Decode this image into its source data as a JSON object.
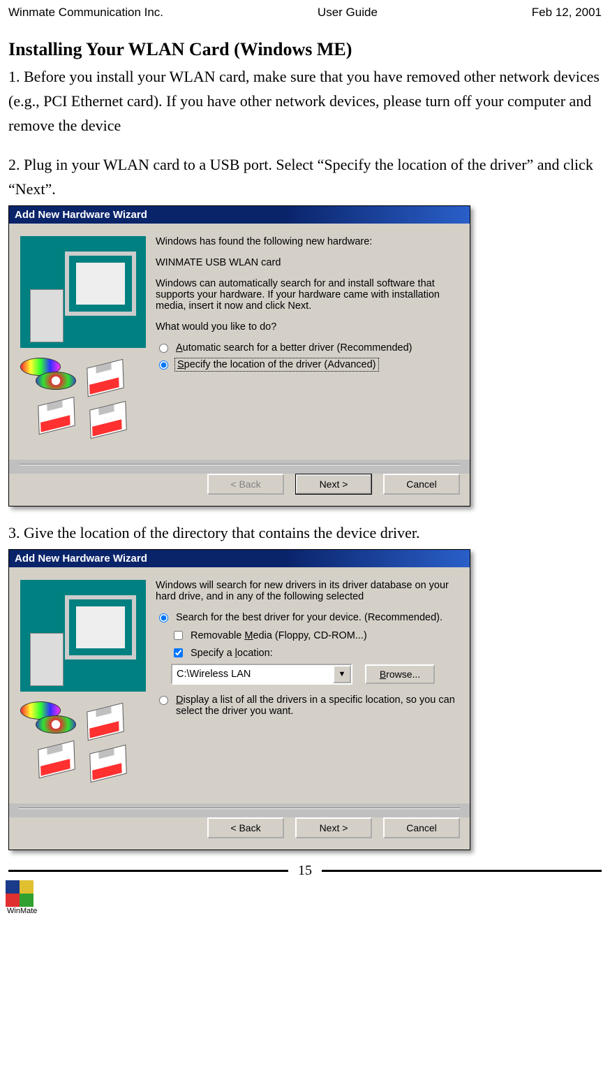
{
  "header": {
    "company": "Winmate Communication Inc.",
    "doc": "User Guide",
    "date": "Feb 12, 2001"
  },
  "sectionTitle": "Installing Your WLAN Card (Windows ME)",
  "para1": "1. Before you install your WLAN card, make sure that you have removed other network devices (e.g., PCI Ethernet card). If you have other network devices, please turn off your computer and remove the device",
  "para2": "2. Plug in your WLAN card to a USB port. Select “Specify the location of the driver” and click “Next”.",
  "para3": "3. Give the location of the directory that contains the device driver.",
  "dialog1": {
    "title": "Add New Hardware Wizard",
    "line1": "Windows has found the following new hardware:",
    "device": "WINMATE USB WLAN card",
    "line2": "Windows can automatically search for and install software that supports your hardware. If your hardware came with installation media, insert it now and click Next.",
    "line3": "What would you like to do?",
    "radio1": {
      "pre": "A",
      "text": "utomatic search for a better driver (Recommended)"
    },
    "radio2": {
      "pre": "S",
      "text": "pecify the location of the driver (Advanced)"
    },
    "back": "< Back",
    "next": "Next >",
    "cancel": "Cancel"
  },
  "dialog2": {
    "title": "Add New Hardware Wizard",
    "line1": "Windows will search for new drivers in its driver database on your hard drive, and in any of the following selected",
    "radio1": "Search for the best driver for your device. (Recommended).",
    "check1": {
      "pre": "Removable ",
      "u": "M",
      "post": "edia (Floppy, CD-ROM...)"
    },
    "check2": {
      "pre": "Specify a ",
      "u": "l",
      "post": "ocation:"
    },
    "path": "C:\\Wireless LAN",
    "browse": {
      "u": "B",
      "text": "rowse..."
    },
    "radio2": {
      "pre": "D",
      "text": "isplay a list of all the drivers in a specific location, so you can select the driver you want."
    },
    "back": "< Back",
    "next": "Next >",
    "cancel": "Cancel"
  },
  "pageNumber": "15",
  "logoText": "WinMate"
}
